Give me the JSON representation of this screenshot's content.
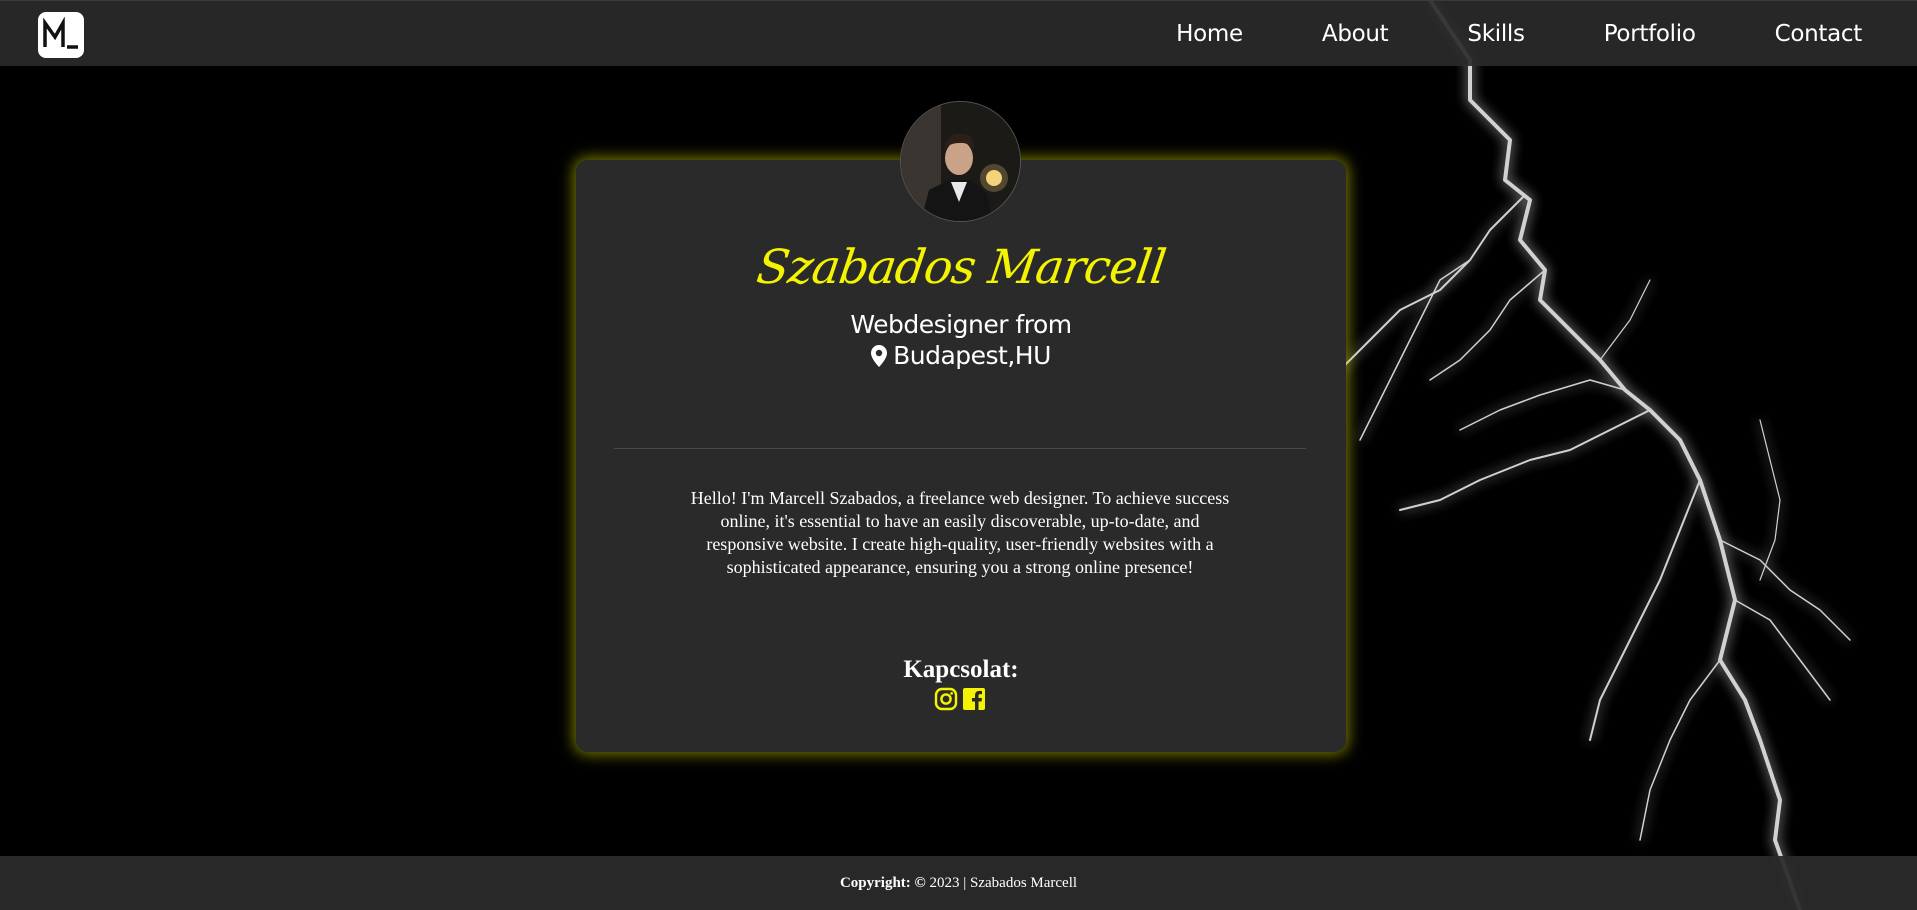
{
  "nav": {
    "logo_text": "ML",
    "links": [
      "Home",
      "About",
      "Skills",
      "Portfolio",
      "Contact"
    ]
  },
  "profile": {
    "name": "Szabados Marcell",
    "subtitle_line1": "Webdesigner from",
    "location": "Budapest,HU",
    "bio": "Hello! I'm Marcell Szabados, a freelance web designer. To achieve success online, it's essential to have an easily discoverable, up-to-date, and responsive website. I create high-quality, user-friendly websites with a sophisticated appearance, ensuring you a strong online presence!",
    "contact_heading": "Kapcsolat:",
    "social_icons": [
      "instagram-icon",
      "facebook-icon"
    ]
  },
  "footer": {
    "label": "Copyright:",
    "copyright_symbol": "©",
    "text": "2023 | Szabados Marcell"
  },
  "colors": {
    "accent": "#f4f400",
    "card_bg": "#2a2a2a",
    "nav_bg": "#2a2a2a",
    "page_bg": "#000000"
  }
}
